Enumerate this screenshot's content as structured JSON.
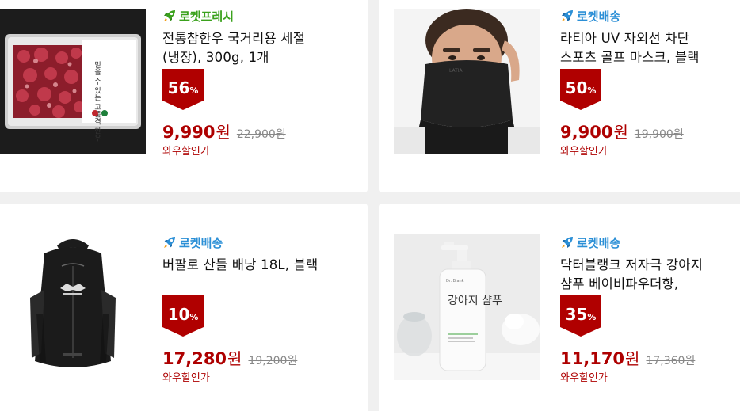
{
  "products": [
    {
      "badge": "로켓프레시",
      "badge_type": "fresh",
      "title": "전통참한우 국거리용 세절 (냉장), 300g, 1개",
      "discount": "56",
      "discount_unit": "%",
      "price": "9,990",
      "price_unit": "원",
      "original_price": "22,900원",
      "promo": "와우할인가",
      "image_icon": "beef-package-image"
    },
    {
      "badge": "로켓배송",
      "badge_type": "rocket",
      "title": "라티아 UV 자외선 차단 스포츠 골프 마스크, 블랙",
      "discount": "50",
      "discount_unit": "%",
      "price": "9,900",
      "price_unit": "원",
      "original_price": "19,900원",
      "promo": "와우할인가",
      "image_icon": "face-mask-image"
    },
    {
      "badge": "로켓배송",
      "badge_type": "rocket",
      "title": "버팔로 산들 배낭 18L, 블랙",
      "discount": "10",
      "discount_unit": "%",
      "price": "17,280",
      "price_unit": "원",
      "original_price": "19,200원",
      "promo": "와우할인가",
      "image_icon": "backpack-image"
    },
    {
      "badge": "로켓배송",
      "badge_type": "rocket",
      "title": "닥터블랭크 저자극 강아지 샴푸 베이비파우더향,",
      "discount": "35",
      "discount_unit": "%",
      "price": "11,170",
      "price_unit": "원",
      "original_price": "17,360원",
      "promo": "와우할인가",
      "image_icon": "shampoo-bottle-image"
    }
  ],
  "product_images": {
    "beef_label_text": "믿을 수 있는 고품격 한우",
    "shampoo_brand": "Dr. Blank",
    "shampoo_label": "강아지 샴푸"
  },
  "colors": {
    "price_red": "#ae0000",
    "discount_badge": "#b00000",
    "rocket_blue": "#2b8fd6",
    "fresh_green": "#3aa11c",
    "page_bg": "#f0f0f0"
  }
}
